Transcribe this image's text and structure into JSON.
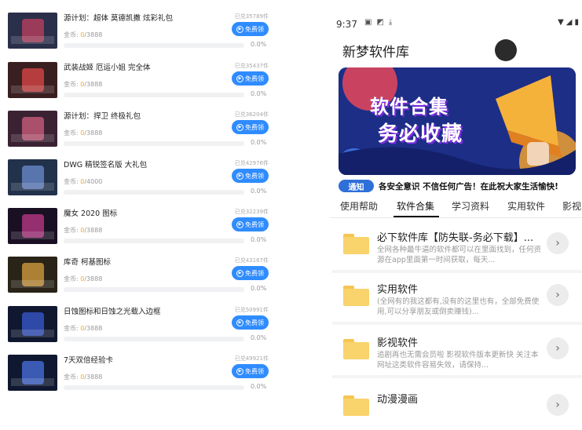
{
  "left": {
    "btn_label": "免费领",
    "btn_icon": "play-circle-icon",
    "rows": [
      {
        "title": "源计划：超体 莫德凯撒 炫彩礼包",
        "claimed": "已兑35789件",
        "gold_prefix": "金币: ",
        "gold_cur": "0",
        "gold_total": "/3888",
        "pct": "0.0%",
        "progress": 0,
        "thumb_color": "#2a2f4a",
        "thumb_accent": "#c04060"
      },
      {
        "title": "武装战姬 厄运小姐 完全体",
        "claimed": "已兑35437件",
        "gold_prefix": "金币: ",
        "gold_cur": "0",
        "gold_total": "/3888",
        "pct": "0.0%",
        "progress": 0,
        "thumb_color": "#3a1f20",
        "thumb_accent": "#e04848"
      },
      {
        "title": "源计划：捍卫 终极礼包",
        "claimed": "已兑36204件",
        "gold_prefix": "金币: ",
        "gold_cur": "0",
        "gold_total": "/3888",
        "pct": "0.0%",
        "progress": 0,
        "thumb_color": "#3a2233",
        "thumb_accent": "#d06080"
      },
      {
        "title": "DWG 精锐签名版 大礼包",
        "claimed": "已兑42976件",
        "gold_prefix": "金币: ",
        "gold_cur": "0",
        "gold_total": "/4000",
        "pct": "0.0%",
        "progress": 0,
        "thumb_color": "#22324a",
        "thumb_accent": "#6c8cd0"
      },
      {
        "title": "魔女 2020 图标",
        "claimed": "已兑32239件",
        "gold_prefix": "金币: ",
        "gold_cur": "0",
        "gold_total": "/3888",
        "pct": "0.0%",
        "progress": 0,
        "thumb_color": "#1a1024",
        "thumb_accent": "#c03a8a"
      },
      {
        "title": "库奇 柯基图标",
        "claimed": "已兑43167件",
        "gold_prefix": "金币: ",
        "gold_cur": "0",
        "gold_total": "/3888",
        "pct": "0.0%",
        "progress": 0,
        "thumb_color": "#2a2418",
        "thumb_accent": "#d8a040"
      },
      {
        "title": "日蚀图标和日蚀之光载入边框",
        "claimed": "已兑50991件",
        "gold_prefix": "金币: ",
        "gold_cur": "0",
        "gold_total": "/3888",
        "pct": "0.0%",
        "progress": 0,
        "thumb_color": "#101830",
        "thumb_accent": "#3a5ad0"
      },
      {
        "title": "7天双倍经验卡",
        "claimed": "已兑49921件",
        "gold_prefix": "金币: ",
        "gold_cur": "0",
        "gold_total": "/3888",
        "pct": "0.0%",
        "progress": 0,
        "thumb_color": "#0f1830",
        "thumb_accent": "#4a70e0"
      }
    ]
  },
  "right": {
    "status": {
      "time": "9:37",
      "left_icons": [
        "image-icon",
        "app-icon",
        "download-icon"
      ],
      "right_icons": [
        "wifi-icon",
        "signal-icon",
        "battery-icon"
      ]
    },
    "app_title": "新梦软件库",
    "banner": {
      "line1": "软件合集",
      "line2": "务必收藏"
    },
    "notice": {
      "tag": "通知",
      "text": "各安全意识 不信任何广告！在此祝大家生活愉快!"
    },
    "tabs": [
      "使用帮助",
      "软件合集",
      "学习资料",
      "实用软件",
      "影视"
    ],
    "active_tab": 1,
    "items": [
      {
        "title": "必下软件库【防失联-务必下载】...",
        "desc": "全网各种最牛逼的软件都可以在里面找到，任何资源在app里面第一时间获取，每天..."
      },
      {
        "title": "实用软件",
        "desc": "(全网有的我这都有,没有的这里也有，全部免费使用,可以分享朋友或倒卖赚钱)..."
      },
      {
        "title": "影视软件",
        "desc": "追剧再也无需会员啦 影视软件版本更新快 关注本网址这类软件容易失效，请保持..."
      },
      {
        "title": "动漫漫画",
        "desc": ""
      }
    ]
  },
  "colors": {
    "accent": "#2f8cff",
    "gold": "#f5a623",
    "tag": "#2f6fd8"
  }
}
